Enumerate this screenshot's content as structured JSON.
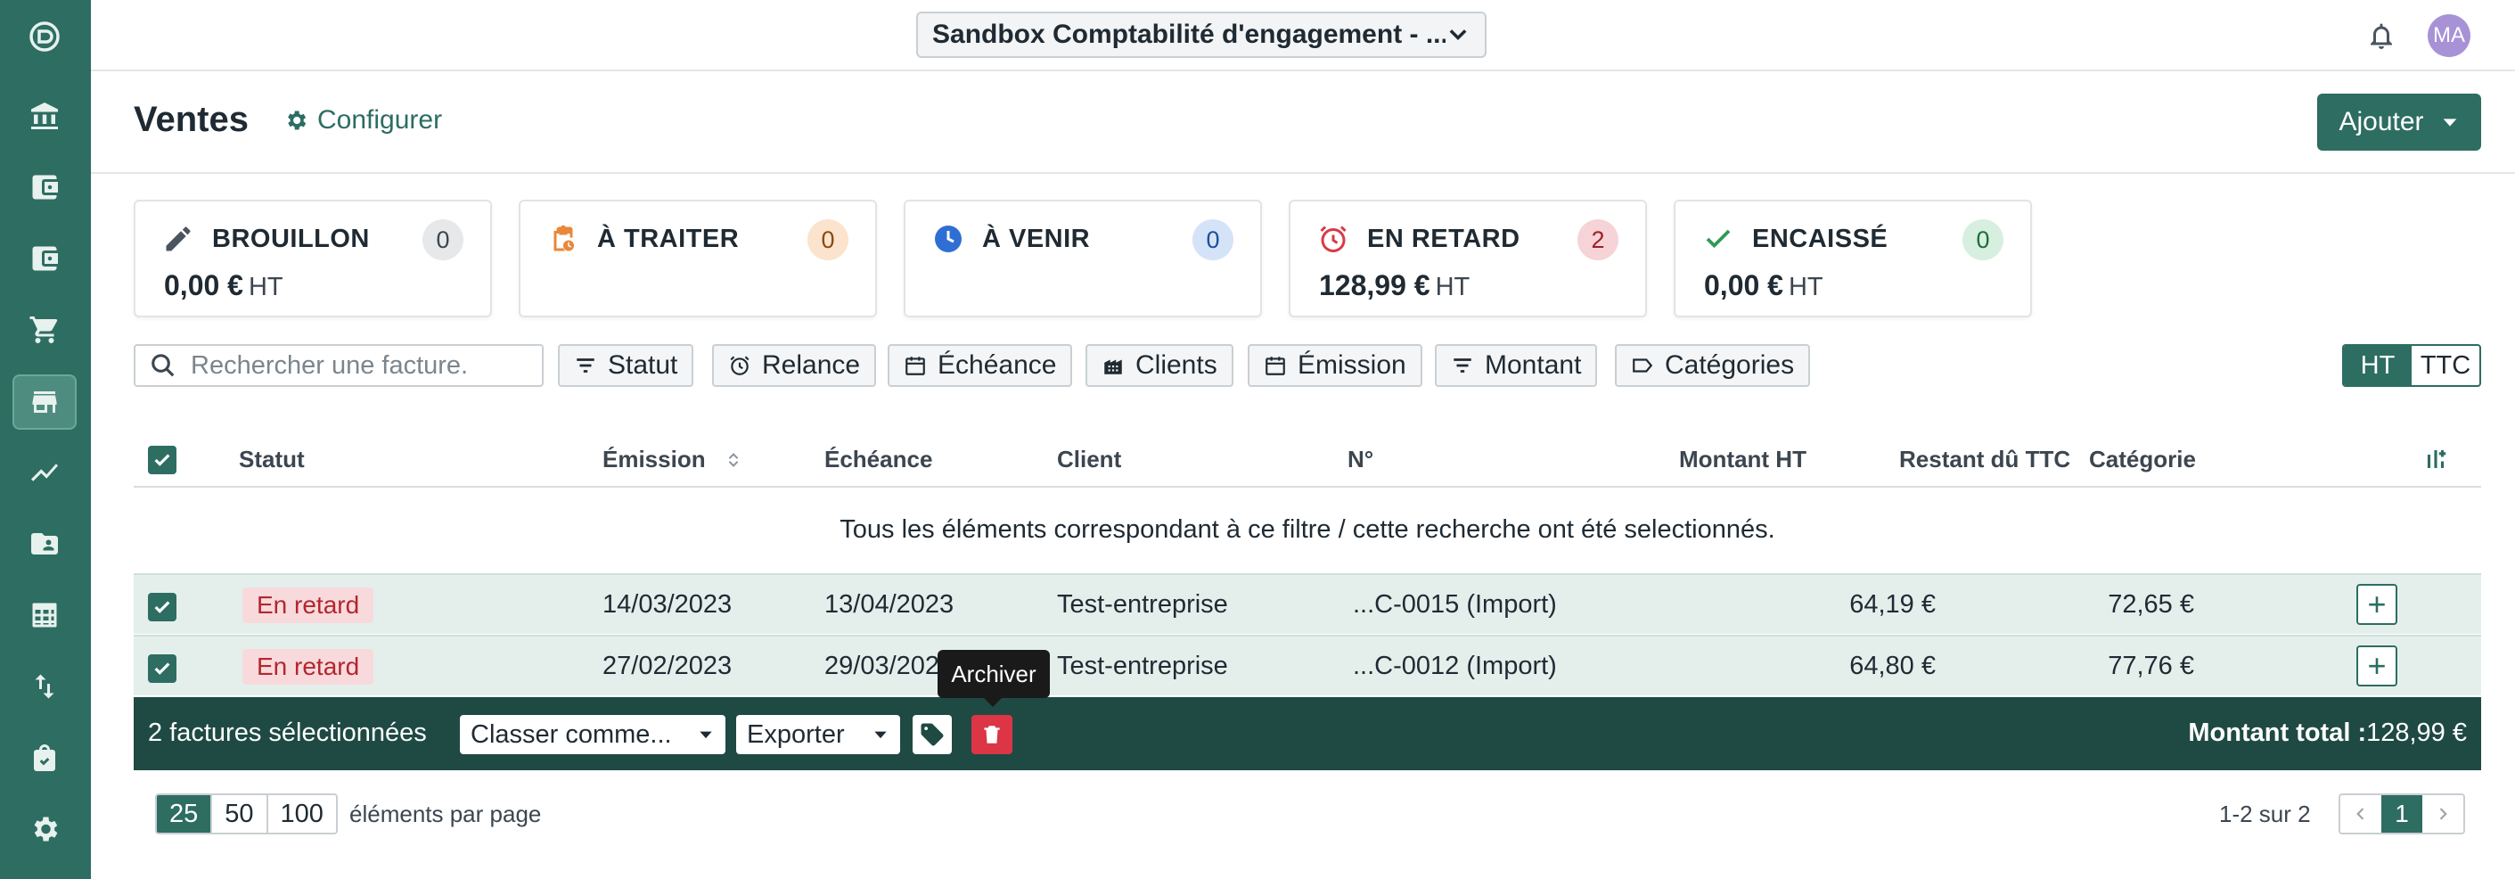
{
  "topbar": {
    "company": "Sandbox Comptabilité d'engagement - ...",
    "avatar_initials": "MA"
  },
  "header": {
    "title": "Ventes",
    "configure_label": "Configurer",
    "add_label": "Ajouter"
  },
  "cards": [
    {
      "label": "BROUILLON",
      "count": "0",
      "amount": "0,00 €",
      "suffix": "HT"
    },
    {
      "label": "À TRAITER",
      "count": "0"
    },
    {
      "label": "À VENIR",
      "count": "0"
    },
    {
      "label": "EN RETARD",
      "count": "2",
      "amount": "128,99 €",
      "suffix": "HT"
    },
    {
      "label": "ENCAISSÉ",
      "count": "0",
      "amount": "0,00 €",
      "suffix": "HT"
    }
  ],
  "search": {
    "placeholder": "Rechercher une facture."
  },
  "filters": [
    "Statut",
    "Relance",
    "Échéance",
    "Clients",
    "Émission",
    "Montant",
    "Catégories"
  ],
  "tax_toggle": {
    "ht": "HT",
    "ttc": "TTC"
  },
  "table": {
    "columns": [
      "Statut",
      "Émission",
      "Échéance",
      "Client",
      "N°",
      "Montant HT",
      "Restant dû TTC",
      "Catégorie"
    ],
    "selection_message": "Tous les éléments correspondant à ce filtre / cette recherche ont été selectionnés.",
    "rows": [
      {
        "status": "En retard",
        "emission": "14/03/2023",
        "echeance": "13/04/2023",
        "client": "Test-entreprise",
        "numero": "...C-0015 (Import)",
        "montant_ht": "64,19 €",
        "restant_ttc": "72,65 €"
      },
      {
        "status": "En retard",
        "emission": "27/02/2023",
        "echeance": "29/03/2023",
        "client": "Test-entreprise",
        "numero": "...C-0012 (Import)",
        "montant_ht": "64,80 €",
        "restant_ttc": "77,76 €"
      }
    ]
  },
  "action_bar": {
    "selected": "2 factures sélectionnées",
    "classify": "Classer comme...",
    "export": "Exporter",
    "total_label": "Montant total :",
    "total_value": "128,99 €"
  },
  "tooltip": "Archiver",
  "pagination": {
    "sizes": [
      "25",
      "50",
      "100"
    ],
    "per_page_label": "éléments par page",
    "range": "1-2 sur 2",
    "current_page": "1"
  },
  "colors": {
    "primary": "#2d6d62",
    "danger": "#dc3545",
    "late_badge_bg": "#f8dadc"
  }
}
